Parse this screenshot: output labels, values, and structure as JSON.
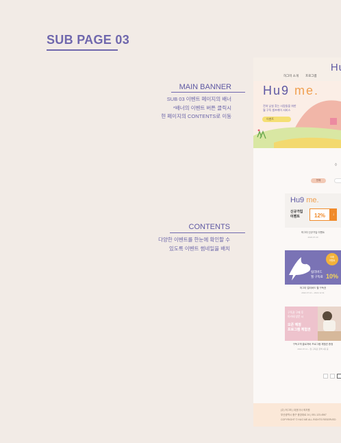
{
  "page_title": "SUB PAGE 03",
  "annotations": {
    "main_banner": {
      "title": "MAIN BANNER",
      "lines": [
        "SUB 03 이벤트 페이지의 배너",
        "*배너의 이벤트 버튼 클릭시",
        "현 페이지의 CONTENTS로 이동"
      ]
    },
    "contents": {
      "title": "CONTENTS",
      "lines": [
        "다양한 이벤트를 한눈에 확인할 수",
        "있도록 이벤트 썸네일을 배치"
      ]
    }
  },
  "mockup": {
    "header": {
      "logo": "Hu",
      "nav": [
        "허그미 소개",
        "프로그램"
      ]
    },
    "banner": {
      "logo_main": "Hu9",
      "logo_accent": "me.",
      "text_lines": [
        "전혀 낯설 찾는 사람들을 위한",
        "월 구독 셀프케어 서비스"
      ],
      "button_label": "이벤트"
    },
    "tabs": [
      "전체"
    ],
    "cards": [
      {
        "logo_main": "Hu9",
        "logo_accent": "me.",
        "headline": [
          "신규가입",
          "이벤트"
        ],
        "discount": "12%",
        "caption": "허그미 신규가입 이벤트",
        "date": "2022.07.20"
      },
      {
        "badge": [
          "아래",
          "이벤트"
        ],
        "headline": [
          "릴리버드",
          "월 구독료"
        ],
        "discount": "10%",
        "caption": "허그미 얼리버드 월 구독권",
        "date": "2022.07.10 ~ 2022.12.31"
      },
      {
        "top_lines": [
          "구독권 구매 후",
          "아카데 방문 시"
        ],
        "headline": [
          "오픈 예정",
          "프로그램 체험권"
        ],
        "caption": "구독고객 클로져바 프로그램 체험권 증정",
        "date": "2022.07.11 ~ 월 구독료 정액 2종 중"
      }
    ],
    "footer": {
      "lines": [
        "(주) 허그미  |  대표이사 최지원",
        "부산광역시 중구 중앙대로 24  |  051-123-4567",
        "COPYRIGHT © HUG ME ALL RIGHTS RESERVED"
      ]
    }
  },
  "colors": {
    "accent": "#6f67ad",
    "bg": "#f2ebe6",
    "banner": "#fbeee6",
    "card_purple": "#7a73b5",
    "card_pink": "#eec3cd",
    "orange": "#f08a2a"
  }
}
